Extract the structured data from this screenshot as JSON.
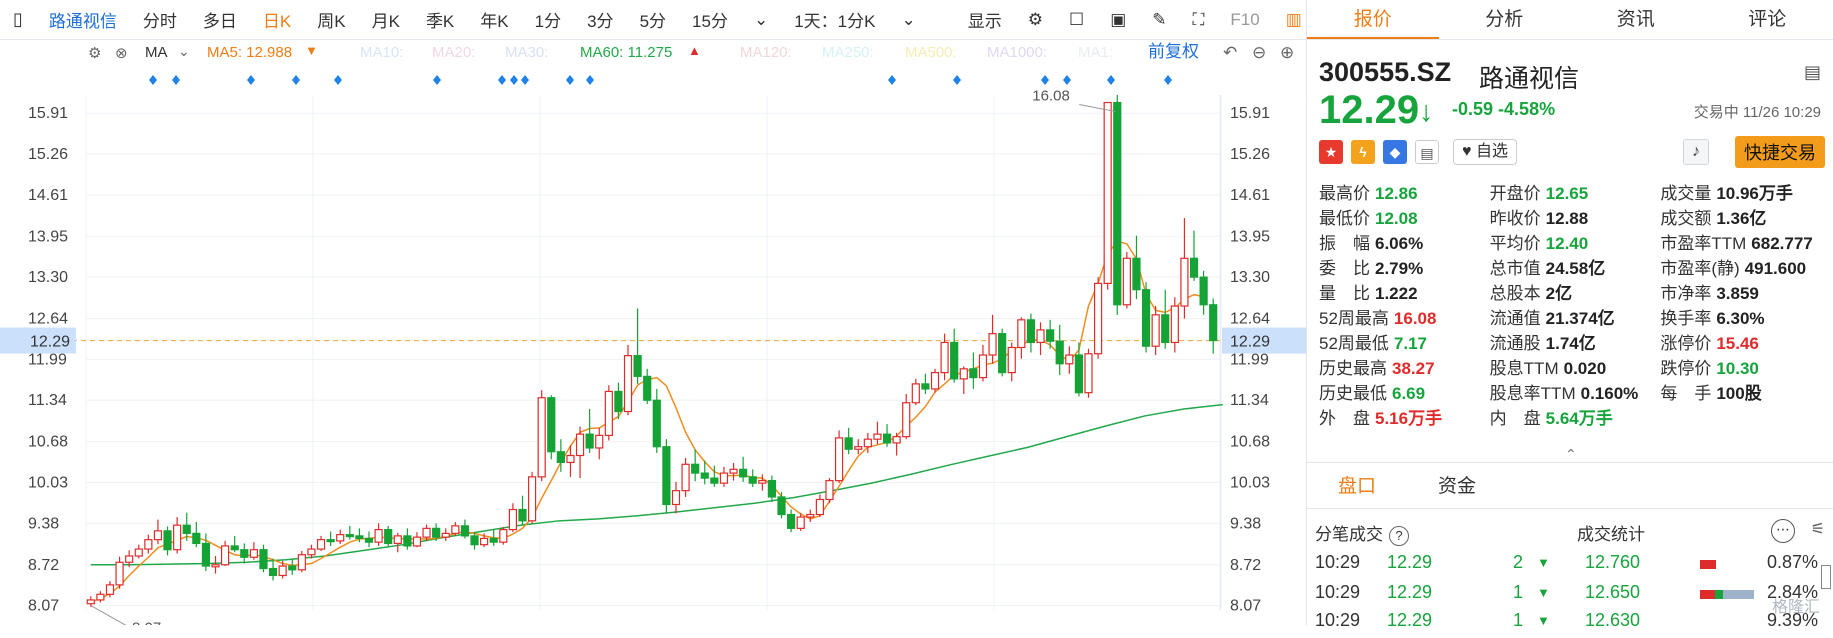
{
  "toolbar": {
    "stock": "路通视信",
    "tabs": [
      "分时",
      "多日",
      "日K",
      "周K",
      "月K",
      "季K",
      "年K",
      "1分",
      "3分",
      "5分",
      "15分"
    ],
    "range": "1天：1分K",
    "display": "显示",
    "f10": "F10"
  },
  "indicator": {
    "ma": "MA",
    "ma5": "MA5: 12.988",
    "ma10": "MA10:",
    "ma20": "MA20:",
    "ma30": "MA30:",
    "ma60": "MA60: 11.275",
    "ma120": "MA120:",
    "ma250": "MA250:",
    "ma500": "MA500:",
    "ma1000": "MA1000:",
    "ma1": "MA1:",
    "restore": "前复权"
  },
  "chart_data": {
    "type": "candlestick",
    "y_ticks": [
      15.91,
      15.26,
      14.61,
      13.95,
      13.3,
      12.64,
      11.99,
      11.34,
      10.68,
      10.03,
      9.38,
      8.72,
      8.07
    ],
    "ylim": [
      8.0,
      16.2
    ],
    "current_price": 12.29,
    "high_label": "16.08",
    "low_label": "8.07",
    "candles": [
      [
        8.1,
        8.22,
        8.05,
        8.16
      ],
      [
        8.16,
        8.3,
        8.12,
        8.25
      ],
      [
        8.25,
        8.46,
        8.2,
        8.4
      ],
      [
        8.4,
        8.85,
        8.34,
        8.76
      ],
      [
        8.76,
        8.95,
        8.68,
        8.86
      ],
      [
        8.86,
        9.04,
        8.82,
        8.97
      ],
      [
        8.97,
        9.2,
        8.9,
        9.12
      ],
      [
        9.12,
        9.44,
        9.05,
        9.26
      ],
      [
        9.26,
        9.33,
        8.87,
        8.96
      ],
      [
        8.96,
        9.48,
        8.9,
        9.35
      ],
      [
        9.35,
        9.55,
        9.1,
        9.22
      ],
      [
        9.22,
        9.4,
        9.0,
        9.06
      ],
      [
        9.06,
        9.22,
        8.62,
        8.7
      ],
      [
        8.7,
        8.86,
        8.58,
        8.72
      ],
      [
        8.72,
        9.1,
        8.7,
        9.02
      ],
      [
        9.02,
        9.18,
        8.92,
        8.96
      ],
      [
        8.96,
        9.06,
        8.74,
        8.84
      ],
      [
        8.84,
        9.08,
        8.8,
        8.96
      ],
      [
        8.96,
        9.04,
        8.6,
        8.66
      ],
      [
        8.66,
        8.82,
        8.47,
        8.55
      ],
      [
        8.55,
        8.78,
        8.5,
        8.7
      ],
      [
        8.7,
        8.82,
        8.56,
        8.64
      ],
      [
        8.64,
        8.94,
        8.6,
        8.88
      ],
      [
        8.88,
        9.04,
        8.82,
        8.97
      ],
      [
        8.97,
        9.18,
        8.94,
        9.12
      ],
      [
        9.12,
        9.25,
        9.02,
        9.1
      ],
      [
        9.1,
        9.28,
        9.05,
        9.2
      ],
      [
        9.2,
        9.34,
        9.12,
        9.18
      ],
      [
        9.18,
        9.3,
        9.08,
        9.14
      ],
      [
        9.14,
        9.25,
        9.0,
        9.08
      ],
      [
        9.08,
        9.38,
        9.02,
        9.28
      ],
      [
        9.28,
        9.34,
        9.0,
        9.06
      ],
      [
        9.06,
        9.23,
        8.92,
        9.18
      ],
      [
        9.18,
        9.3,
        8.96,
        9.02
      ],
      [
        9.02,
        9.24,
        9.0,
        9.16
      ],
      [
        9.16,
        9.36,
        9.1,
        9.3
      ],
      [
        9.3,
        9.38,
        9.1,
        9.16
      ],
      [
        9.16,
        9.3,
        9.1,
        9.22
      ],
      [
        9.22,
        9.4,
        9.18,
        9.34
      ],
      [
        9.34,
        9.44,
        9.14,
        9.18
      ],
      [
        9.18,
        9.24,
        8.96,
        9.04
      ],
      [
        9.04,
        9.22,
        9.0,
        9.14
      ],
      [
        9.14,
        9.28,
        9.02,
        9.08
      ],
      [
        9.08,
        9.32,
        9.04,
        9.28
      ],
      [
        9.28,
        9.7,
        9.24,
        9.6
      ],
      [
        9.6,
        9.82,
        9.35,
        9.42
      ],
      [
        9.42,
        10.2,
        9.38,
        10.12
      ],
      [
        10.12,
        11.5,
        10.05,
        11.38
      ],
      [
        11.38,
        11.42,
        10.4,
        10.52
      ],
      [
        10.52,
        10.72,
        10.2,
        10.35
      ],
      [
        10.35,
        10.62,
        10.12,
        10.46
      ],
      [
        10.46,
        10.92,
        10.1,
        10.8
      ],
      [
        10.8,
        11.2,
        10.5,
        10.58
      ],
      [
        10.58,
        10.9,
        10.4,
        10.78
      ],
      [
        10.78,
        11.58,
        10.7,
        11.48
      ],
      [
        11.48,
        11.62,
        11.04,
        11.16
      ],
      [
        11.16,
        12.22,
        11.1,
        12.05
      ],
      [
        12.05,
        12.8,
        11.6,
        11.72
      ],
      [
        11.72,
        11.84,
        11.28,
        11.34
      ],
      [
        11.34,
        11.52,
        10.5,
        10.6
      ],
      [
        10.6,
        10.72,
        9.54,
        9.68
      ],
      [
        9.68,
        10.04,
        9.54,
        9.9
      ],
      [
        9.9,
        10.42,
        9.8,
        10.32
      ],
      [
        10.32,
        10.56,
        10.05,
        10.18
      ],
      [
        10.18,
        10.38,
        10.0,
        10.1
      ],
      [
        10.1,
        10.3,
        9.96,
        10.02
      ],
      [
        10.02,
        10.28,
        9.96,
        10.18
      ],
      [
        10.18,
        10.34,
        10.06,
        10.24
      ],
      [
        10.24,
        10.44,
        10.04,
        10.12
      ],
      [
        10.12,
        10.24,
        9.96,
        10.02
      ],
      [
        10.02,
        10.16,
        9.9,
        10.06
      ],
      [
        10.06,
        10.14,
        9.72,
        9.8
      ],
      [
        9.8,
        9.88,
        9.46,
        9.52
      ],
      [
        9.52,
        9.6,
        9.24,
        9.3
      ],
      [
        9.3,
        9.54,
        9.26,
        9.48
      ],
      [
        9.48,
        9.6,
        9.4,
        9.52
      ],
      [
        9.52,
        9.84,
        9.48,
        9.76
      ],
      [
        9.76,
        10.1,
        9.7,
        10.06
      ],
      [
        10.06,
        10.86,
        10.02,
        10.74
      ],
      [
        10.74,
        10.9,
        10.48,
        10.56
      ],
      [
        10.56,
        10.72,
        10.48,
        10.6
      ],
      [
        10.6,
        10.82,
        10.5,
        10.72
      ],
      [
        10.72,
        11.0,
        10.64,
        10.8
      ],
      [
        10.8,
        10.96,
        10.6,
        10.66
      ],
      [
        10.66,
        10.82,
        10.46,
        10.76
      ],
      [
        10.76,
        11.44,
        10.72,
        11.3
      ],
      [
        11.3,
        11.68,
        11.26,
        11.6
      ],
      [
        11.6,
        11.76,
        11.44,
        11.52
      ],
      [
        11.52,
        11.84,
        11.46,
        11.78
      ],
      [
        11.78,
        12.4,
        11.66,
        12.26
      ],
      [
        12.26,
        12.48,
        11.62,
        11.68
      ],
      [
        11.68,
        11.88,
        11.44,
        11.84
      ],
      [
        11.84,
        12.1,
        11.52,
        11.7
      ],
      [
        11.7,
        12.22,
        11.64,
        12.06
      ],
      [
        12.06,
        12.7,
        11.92,
        12.4
      ],
      [
        12.4,
        12.48,
        11.72,
        11.78
      ],
      [
        11.78,
        12.26,
        11.64,
        12.18
      ],
      [
        12.18,
        12.66,
        12.0,
        12.62
      ],
      [
        12.62,
        12.72,
        12.1,
        12.26
      ],
      [
        12.26,
        12.58,
        12.06,
        12.46
      ],
      [
        12.46,
        12.62,
        12.16,
        12.28
      ],
      [
        12.28,
        12.54,
        11.74,
        11.92
      ],
      [
        11.92,
        12.2,
        11.76,
        12.06
      ],
      [
        12.06,
        12.26,
        11.4,
        11.46
      ],
      [
        11.46,
        12.16,
        11.38,
        12.08
      ],
      [
        12.08,
        13.3,
        12.0,
        13.2
      ],
      [
        13.2,
        16.08,
        13.1,
        16.08
      ],
      [
        16.08,
        16.2,
        12.7,
        12.86
      ],
      [
        12.86,
        13.7,
        12.8,
        13.6
      ],
      [
        13.6,
        13.96,
        12.95,
        13.1
      ],
      [
        13.1,
        13.22,
        12.1,
        12.2
      ],
      [
        12.2,
        12.84,
        12.06,
        12.7
      ],
      [
        12.7,
        13.1,
        12.16,
        12.26
      ],
      [
        12.26,
        12.98,
        12.1,
        12.84
      ],
      [
        12.84,
        14.24,
        12.64,
        13.6
      ],
      [
        13.6,
        14.04,
        13.24,
        13.3
      ],
      [
        13.3,
        13.4,
        12.7,
        12.86
      ],
      [
        12.86,
        12.96,
        12.08,
        12.29
      ]
    ],
    "ma5": [
      8.13,
      8.18,
      8.26,
      8.38,
      8.55,
      8.7,
      8.84,
      8.99,
      9.05,
      9.11,
      9.17,
      9.15,
      9.11,
      9.03,
      8.95,
      8.88,
      8.86,
      8.88,
      8.85,
      8.8,
      8.74,
      8.71,
      8.72,
      8.74,
      8.82,
      8.91,
      9.0,
      9.08,
      9.13,
      9.14,
      9.16,
      9.15,
      9.14,
      9.13,
      9.13,
      9.13,
      9.14,
      9.17,
      9.22,
      9.25,
      9.22,
      9.18,
      9.15,
      9.14,
      9.21,
      9.3,
      9.47,
      9.78,
      10.06,
      10.35,
      10.61,
      10.83,
      10.89,
      10.9,
      10.99,
      11.08,
      11.32,
      11.58,
      11.67,
      11.7,
      11.57,
      11.22,
      10.83,
      10.55,
      10.36,
      10.2,
      10.14,
      10.14,
      10.15,
      10.11,
      10.1,
      9.99,
      9.81,
      9.64,
      9.53,
      9.45,
      9.5,
      9.73,
      9.97,
      10.22,
      10.45,
      10.59,
      10.63,
      10.67,
      10.77,
      10.93,
      11.07,
      11.24,
      11.47,
      11.6,
      11.74,
      11.79,
      11.84,
      11.9,
      11.93,
      12.0,
      12.13,
      12.22,
      12.3,
      12.3,
      12.22,
      12.06,
      11.96,
      12.14,
      12.84,
      13.2,
      13.67,
      13.87,
      13.83,
      13.59,
      13.03,
      12.77,
      12.74,
      12.81,
      12.95,
      13.02,
      12.99
    ],
    "ma60_start": [
      8.72,
      8.72,
      8.73,
      8.74,
      8.76,
      8.8,
      8.86,
      8.95,
      9.04,
      9.15,
      9.25,
      9.35,
      9.42,
      9.45,
      9.5,
      9.56,
      9.63,
      9.7,
      9.79,
      9.9,
      10.02,
      10.16,
      10.31,
      10.45,
      10.59,
      10.76,
      10.93,
      11.09,
      11.2,
      11.27
    ],
    "ma60_x_start_index": 0,
    "ma60_x_end_index": 118
  },
  "quote": {
    "tabs": [
      "报价",
      "分析",
      "资讯",
      "评论"
    ],
    "code": "300555.SZ",
    "name": "路通视信",
    "price": "12.29",
    "change": "-0.59",
    "change_pct": "-4.58%",
    "status": "交易中 11/26 10:29",
    "watch": "自选",
    "quick": "快捷交易",
    "rows": [
      [
        [
          "最高价",
          "12.86",
          "g"
        ],
        [
          "开盘价",
          "12.65",
          "g"
        ],
        [
          "成交量",
          "10.96万手",
          ""
        ]
      ],
      [
        [
          "最低价",
          "12.08",
          "g"
        ],
        [
          "昨收价",
          "12.88",
          ""
        ],
        [
          "成交额",
          "1.36亿",
          ""
        ]
      ],
      [
        [
          "振　幅",
          "6.06%",
          ""
        ],
        [
          "平均价",
          "12.40",
          "g"
        ],
        [
          "市盈率TTM",
          "682.777",
          ""
        ]
      ],
      [
        [
          "委　比",
          "2.79%",
          ""
        ],
        [
          "总市值",
          "24.58亿",
          ""
        ],
        [
          "市盈率(静)",
          "491.600",
          ""
        ]
      ],
      [
        [
          "量　比",
          "1.222",
          ""
        ],
        [
          "总股本",
          "2亿",
          ""
        ],
        [
          "市净率",
          "3.859",
          ""
        ]
      ],
      [
        [
          "52周最高",
          "16.08",
          "r"
        ],
        [
          "流通值",
          "21.374亿",
          ""
        ],
        [
          "换手率",
          "6.30%",
          ""
        ]
      ],
      [
        [
          "52周最低",
          "7.17",
          "g"
        ],
        [
          "流通股",
          "1.74亿",
          ""
        ],
        [
          "涨停价",
          "15.46",
          "r"
        ]
      ],
      [
        [
          "历史最高",
          "38.27",
          "r"
        ],
        [
          "股息TTM",
          "0.020",
          ""
        ],
        [
          "跌停价",
          "10.30",
          "g"
        ]
      ],
      [
        [
          "历史最低",
          "6.69",
          "g"
        ],
        [
          "股息率TTM",
          "0.160%",
          ""
        ],
        [
          "每　手",
          "100股",
          ""
        ]
      ],
      [
        [
          "外　盘",
          "5.16万手",
          "r"
        ],
        [
          "内　盘",
          "5.64万手",
          "g"
        ],
        [
          "",
          "",
          ""
        ]
      ]
    ],
    "subtabs": [
      "盘口",
      "资金"
    ],
    "trades_title": "分笔成交",
    "stats_title": "成交统计",
    "trades": [
      {
        "time": "10:29",
        "price": "12.29",
        "vol": "2",
        "stat": "12.760",
        "pct": "0.87%"
      },
      {
        "time": "10:29",
        "price": "12.29",
        "vol": "1",
        "stat": "12.650",
        "pct": "2.84%"
      },
      {
        "time": "10:29",
        "price": "12.29",
        "vol": "1",
        "stat": "12.630",
        "pct": "9.39%"
      }
    ],
    "watermark": "格隆汇"
  }
}
